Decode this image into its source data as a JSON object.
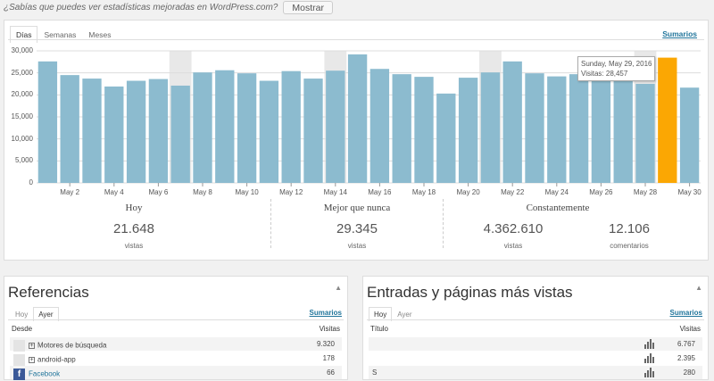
{
  "notice": {
    "text": "¿Sabías que puedes ver estadísticas mejoradas en WordPress.com?",
    "button": "Mostrar"
  },
  "chart_panel": {
    "tabs": [
      "Días",
      "Semanas",
      "Meses"
    ],
    "active_tab": "Días",
    "summary_link": "Sumarios",
    "tooltip": {
      "date": "Sunday, May 29, 2016",
      "visits": "Visitas: 28,457"
    }
  },
  "chart_data": {
    "type": "bar",
    "categories": [
      "May 1",
      "May 2",
      "May 3",
      "May 4",
      "May 5",
      "May 6",
      "May 7",
      "May 8",
      "May 9",
      "May 10",
      "May 11",
      "May 12",
      "May 13",
      "May 14",
      "May 15",
      "May 16",
      "May 17",
      "May 18",
      "May 19",
      "May 20",
      "May 21",
      "May 22",
      "May 23",
      "May 24",
      "May 25",
      "May 26",
      "May 27",
      "May 28",
      "May 29",
      "May 30"
    ],
    "x_tick_labels": [
      "May 2",
      "May 4",
      "May 6",
      "May 8",
      "May 10",
      "May 12",
      "May 14",
      "May 16",
      "May 18",
      "May 20",
      "May 22",
      "May 24",
      "May 26",
      "May 28",
      "May 30"
    ],
    "values": [
      27600,
      24500,
      23700,
      21900,
      23200,
      23600,
      22100,
      25100,
      25600,
      24900,
      23200,
      25400,
      23700,
      25500,
      29200,
      25900,
      24700,
      24100,
      20300,
      23900,
      25100,
      27600,
      24900,
      24200,
      24700,
      23400,
      23800,
      22500,
      28457,
      21648
    ],
    "highlight": "May 29",
    "ylim": [
      0,
      30000
    ],
    "y_ticks": [
      "0",
      "5,000",
      "10,000",
      "15,000",
      "20,000",
      "25,000",
      "30,000"
    ],
    "weekend_shading": [
      "May 7",
      "May 14",
      "May 21",
      "May 28"
    ],
    "bar_color": "#8cbbcf",
    "highlight_color": "#fba703"
  },
  "stats": {
    "today": {
      "heading": "Hoy",
      "value": "21.648",
      "label": "vistas"
    },
    "best": {
      "heading": "Mejor que nunca",
      "value": "29.345",
      "label": "vistas"
    },
    "all_time": {
      "heading": "Constantemente",
      "views_value": "4.362.610",
      "views_label": "vistas",
      "comments_value": "12.106",
      "comments_label": "comentarios"
    }
  },
  "referrers": {
    "title": "Referencias",
    "tabs": [
      "Hoy",
      "Ayer"
    ],
    "summary_link": "Sumarios",
    "col_from": "Desde",
    "col_visits": "Visitas",
    "rows": [
      {
        "label": "Motores de búsqueda",
        "value": "9.320"
      },
      {
        "label": "android-app",
        "value": "178"
      },
      {
        "label": "Facebook",
        "value": "66"
      }
    ]
  },
  "top_posts": {
    "title": "Entradas y páginas más vistas",
    "tabs": [
      "Hoy",
      "Ayer"
    ],
    "summary_link": "Sumarios",
    "col_title": "Título",
    "col_visits": "Visitas",
    "rows": [
      {
        "label": "",
        "value": "6.767"
      },
      {
        "label": "",
        "value": "2.395"
      },
      {
        "label": "S",
        "value": "280"
      }
    ]
  }
}
